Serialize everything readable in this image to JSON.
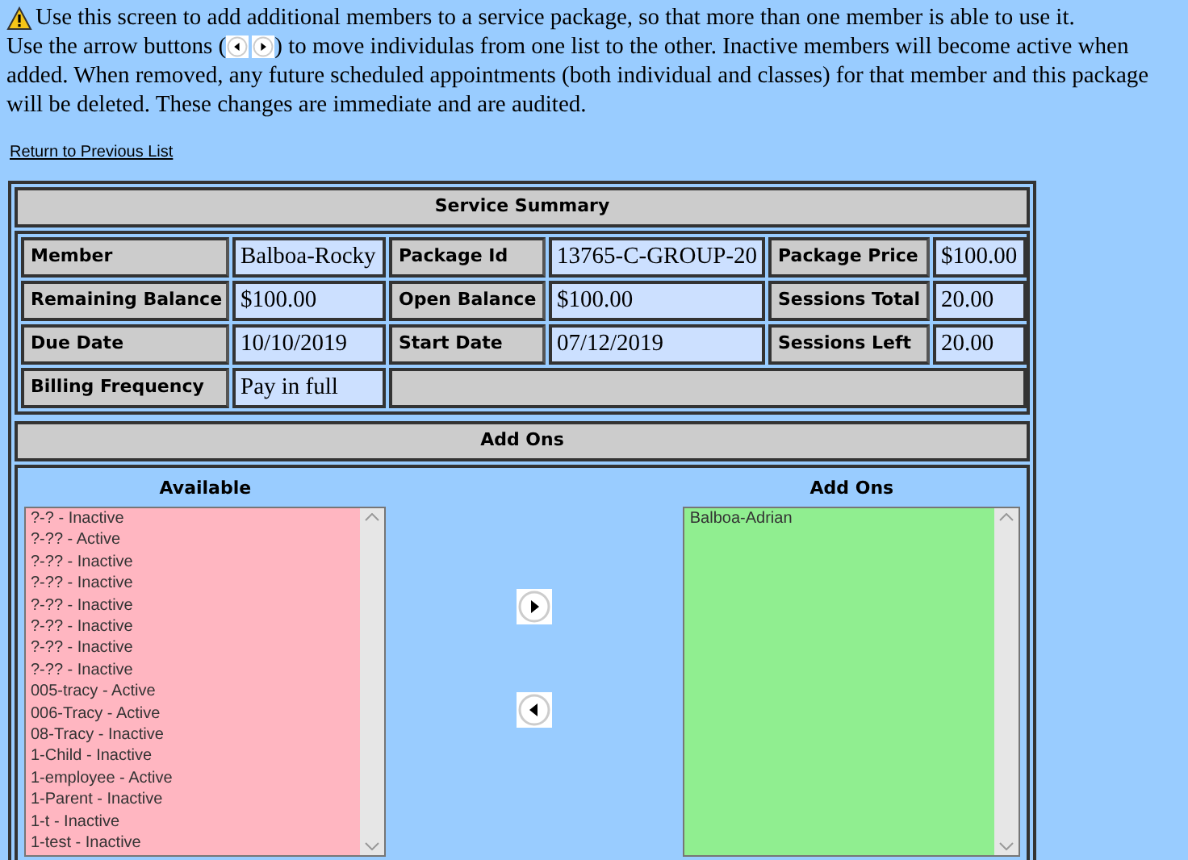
{
  "intro": {
    "first": "Use this screen to add additional members to a service package, so that more than one member is able to use it.",
    "before": "Use the arrow buttons (",
    "after": ") to move individulas from one list to the other. Inactive members will become active when",
    "rest": "added. When removed, any future scheduled appointments (both individual and classes) for that member and this package will be deleted. These changes are immediate and are audited."
  },
  "return_link": "Return to Previous List",
  "summary": {
    "title": "Service Summary",
    "rows": [
      [
        {
          "label": "Member",
          "value": "Balboa-Rocky"
        },
        {
          "label": "Package Id",
          "value": "13765-C-GROUP-20"
        },
        {
          "label": "Package Price",
          "value": "$100.00"
        }
      ],
      [
        {
          "label": "Remaining Balance",
          "value": "$100.00"
        },
        {
          "label": "Open Balance",
          "value": "$100.00"
        },
        {
          "label": "Sessions Total",
          "value": "20.00"
        }
      ],
      [
        {
          "label": "Due Date",
          "value": "10/10/2019"
        },
        {
          "label": "Start Date",
          "value": "07/12/2019"
        },
        {
          "label": "Sessions Left",
          "value": "20.00"
        }
      ],
      [
        {
          "label": "Billing Frequency",
          "value": "Pay in full"
        }
      ]
    ]
  },
  "add_ons": {
    "title": "Add Ons",
    "available": {
      "heading": "Available",
      "items": [
        "?-? - Inactive",
        "?-?? - Active",
        "?-?? - Inactive",
        "?-?? - Inactive",
        "?-?? - Inactive",
        "?-?? - Inactive",
        "?-?? - Inactive",
        "?-?? - Inactive",
        "005-tracy - Active",
        "006-Tracy - Active",
        "08-Tracy - Inactive",
        "1-Child - Inactive",
        "1-employee - Active",
        "1-Parent - Inactive",
        "1-t - Inactive",
        "1-test - Inactive"
      ]
    },
    "added": {
      "heading": "Add Ons",
      "items": [
        "Balboa-Adrian"
      ]
    }
  }
}
